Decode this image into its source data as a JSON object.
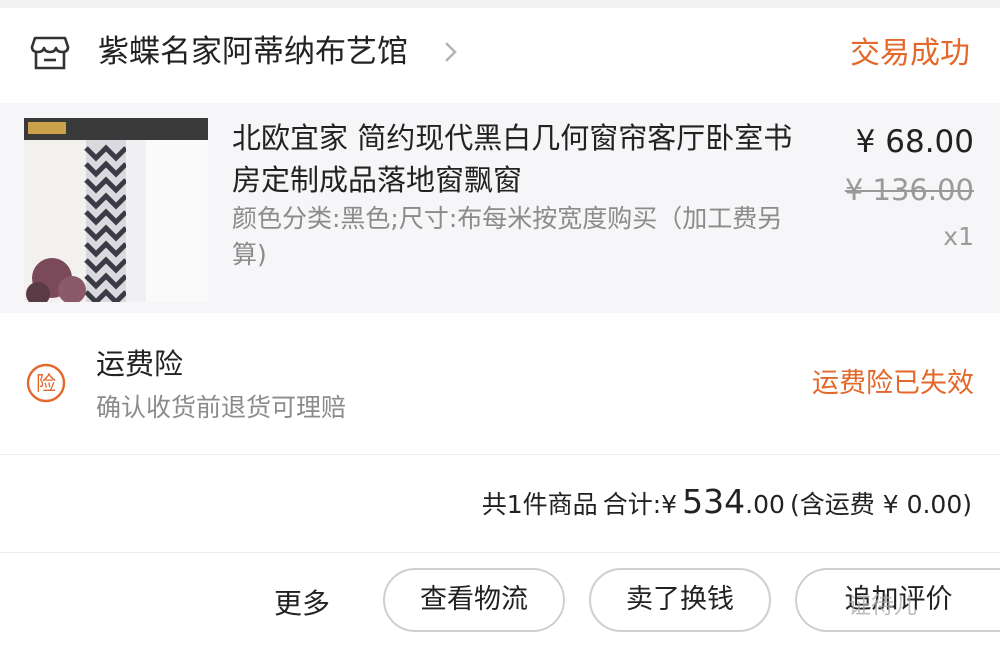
{
  "shop": {
    "name": "紫蝶名家阿蒂纳布艺馆",
    "status": "交易成功"
  },
  "product": {
    "title": "北欧宜家 简约现代黑白几何窗帘客厅卧室书房定制成品落地窗飘窗",
    "spec": "颜色分类:黑色;尺寸:布每米按宽度购买（加工费另算)",
    "price": "¥ 68.00",
    "original_price": "¥ 136.00",
    "quantity": "x1"
  },
  "insurance": {
    "badge": "险",
    "title": "运费险",
    "subtitle": "确认收货前退货可理赔",
    "status": "运费险已失效"
  },
  "summary": {
    "count_text": "共1件商品",
    "total_label": "合计:",
    "currency": "¥",
    "amount_int": "534",
    "amount_dec": ".00",
    "shipping_text": "(含运费 ¥ 0.00)"
  },
  "actions": {
    "more": "更多",
    "logistics": "查看物流",
    "sell": "卖了换钱",
    "review": "追加评价"
  },
  "watermark": "证待儿",
  "colors": {
    "accent": "#e4672b",
    "background": "#f2f2f2",
    "product_bg": "#f6f5f7"
  }
}
